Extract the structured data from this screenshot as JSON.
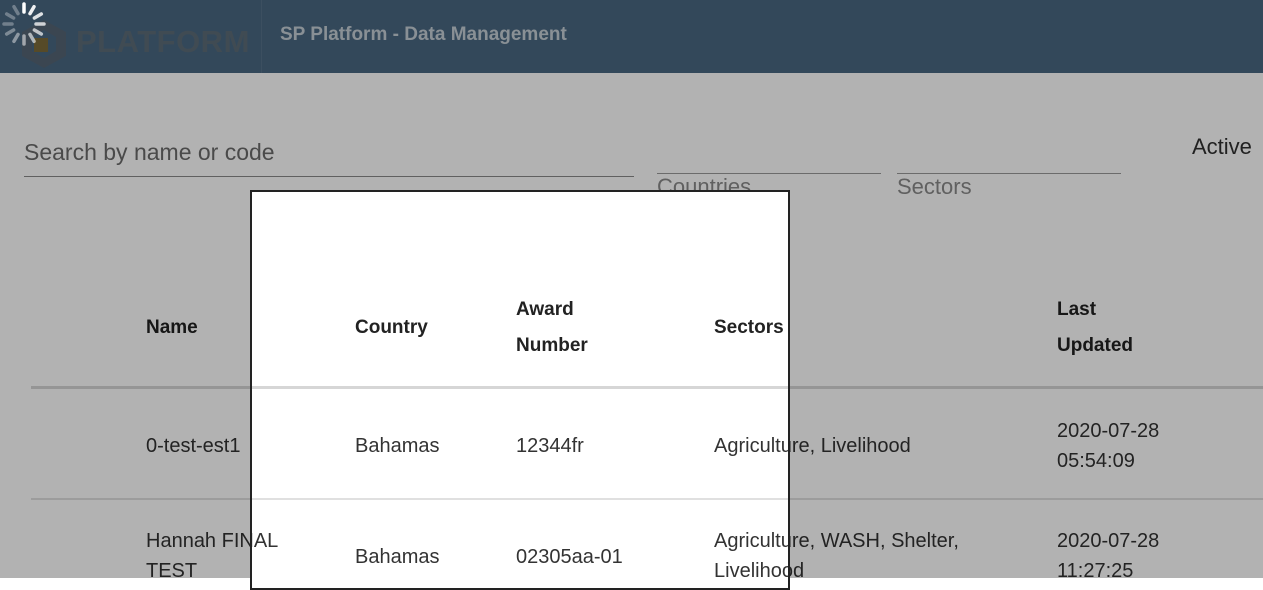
{
  "header": {
    "logo_text": "PLATFORM",
    "app_title": "SP Platform - Data Management"
  },
  "filters": {
    "search_placeholder": "Search by name or code",
    "countries_label": "Countries",
    "sectors_label": "Sectors",
    "active_label": "Active"
  },
  "table": {
    "columns": {
      "name": "Name",
      "country": "Country",
      "award_number": "Award Number",
      "sectors": "Sectors",
      "last_updated": "Last Updated"
    },
    "rows": [
      {
        "name": "0-test-est1",
        "country": "Bahamas",
        "award_number": "12344fr",
        "sectors": "Agriculture, Livelihood",
        "last_updated": "2020-07-28 05:54:09"
      },
      {
        "name": "Hannah FINAL TEST",
        "country": "Bahamas",
        "award_number": "02305aa-01",
        "sectors": "Agriculture, WASH, Shelter, Livelihood",
        "last_updated": "2020-07-28 11:27:25"
      }
    ]
  },
  "colors": {
    "header_bg": "#4a6882",
    "overlay": "rgba(0,0,0,0.30)"
  }
}
